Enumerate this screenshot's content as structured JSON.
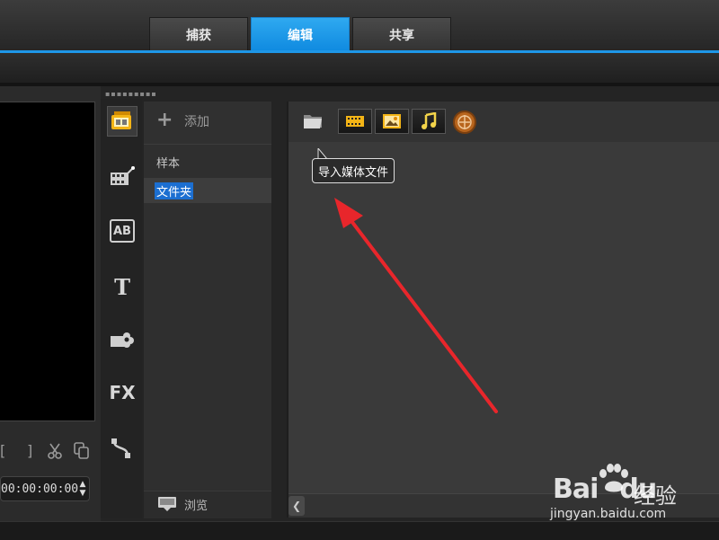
{
  "tabs": [
    {
      "label": "捕获",
      "active": false
    },
    {
      "label": "编辑",
      "active": true
    },
    {
      "label": "共享",
      "active": false
    }
  ],
  "preview": {
    "timecode": "00:00:00:00"
  },
  "categories": [
    {
      "icon": "media-icon",
      "selected": true
    },
    {
      "icon": "instant-project-icon",
      "selected": false
    },
    {
      "icon": "transition-icon",
      "label": "AB",
      "selected": false
    },
    {
      "icon": "title-icon",
      "label": "T",
      "selected": false
    },
    {
      "icon": "graphic-icon",
      "selected": false
    },
    {
      "icon": "filter-icon",
      "label": "FX",
      "selected": false
    },
    {
      "icon": "path-icon",
      "selected": false
    }
  ],
  "tree": {
    "add_label": "添加",
    "items": [
      "样本",
      "文件夹"
    ],
    "selected": "文件夹",
    "browse_label": "浏览"
  },
  "media_toolbar": {
    "buttons": [
      "import-folder-icon",
      "video-filter-icon",
      "photo-filter-icon",
      "audio-filter-icon",
      "sort-icon"
    ],
    "tooltip": "导入媒体文件"
  },
  "colors": {
    "accent": "#1e97e8",
    "annotation_arrow": "#e8262b",
    "selection": "#1c6fd1"
  },
  "watermark": {
    "brand": "Bai",
    "brand_mid": "du",
    "cn": "经验",
    "url": "jingyan.baidu.com"
  }
}
